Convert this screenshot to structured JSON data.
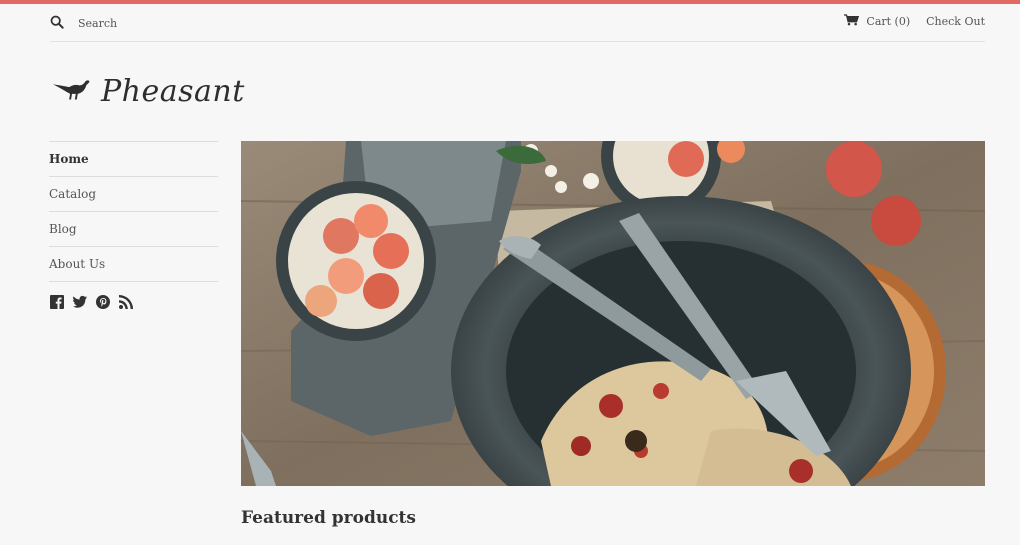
{
  "header": {
    "search_label": "Search",
    "cart_label": "Cart (0)",
    "checkout_label": "Check Out"
  },
  "logo": {
    "text": "Pheasant",
    "icon": "pheasant-bird-icon"
  },
  "nav": {
    "items": [
      {
        "label": "Home",
        "active": true
      },
      {
        "label": "Catalog",
        "active": false
      },
      {
        "label": "Blog",
        "active": false
      },
      {
        "label": "About Us",
        "active": false
      }
    ]
  },
  "social": [
    "facebook-icon",
    "twitter-icon",
    "pinterest-icon",
    "rss-icon"
  ],
  "hero": {
    "alt": "food flat-lay with bowls of berries, grater and plate"
  },
  "featured": {
    "title": "Featured products"
  },
  "colors": {
    "accent": "#e26a64",
    "background": "#f7f7f7",
    "text": "#333333"
  }
}
